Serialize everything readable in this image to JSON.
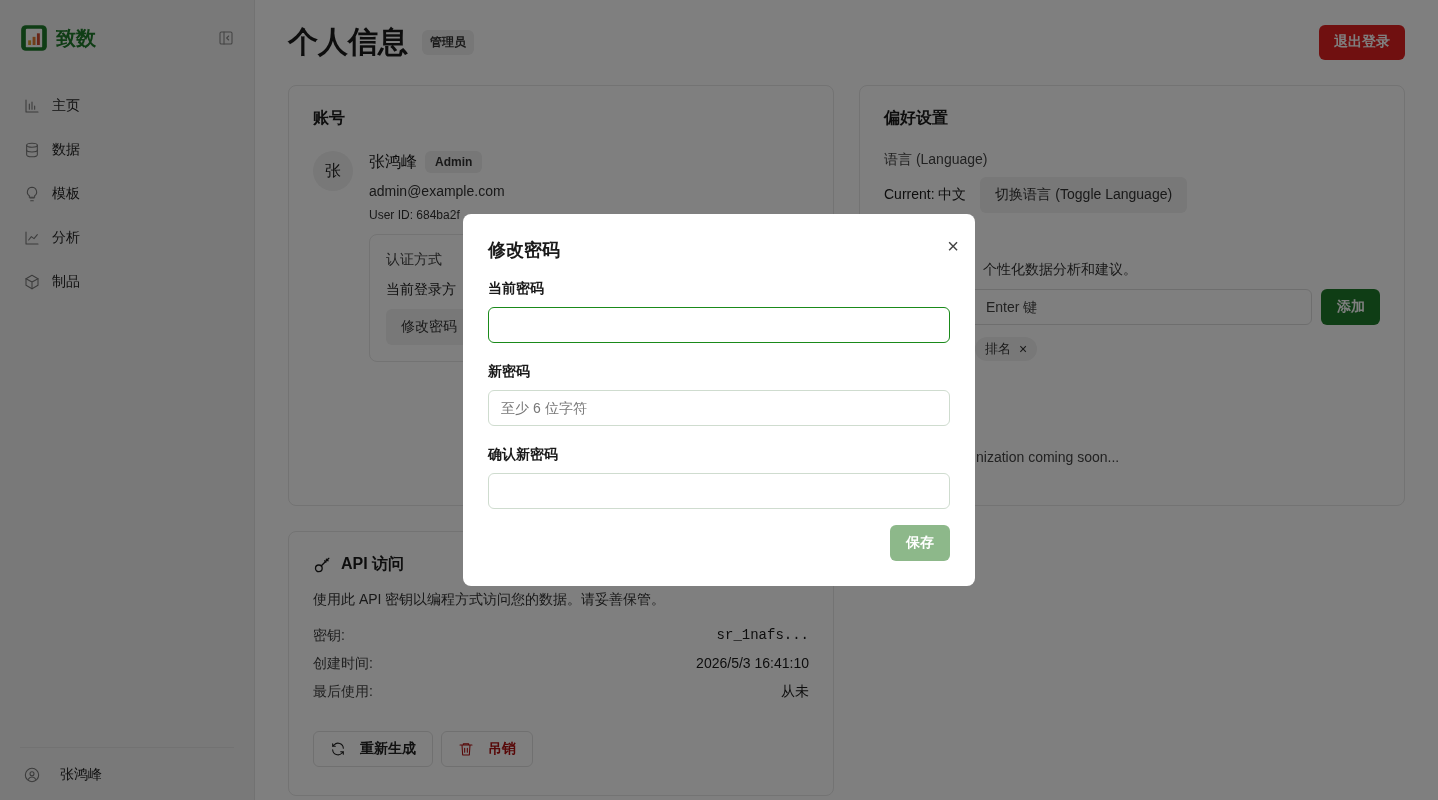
{
  "sidebar": {
    "brand": "致数",
    "nav": [
      {
        "label": "主页"
      },
      {
        "label": "数据"
      },
      {
        "label": "模板"
      },
      {
        "label": "分析"
      },
      {
        "label": "制品"
      }
    ],
    "user": "张鸿峰"
  },
  "header": {
    "title": "个人信息",
    "badge": "管理员",
    "logout": "退出登录"
  },
  "account_card": {
    "title": "账号",
    "avatar": "张",
    "name": "张鸿峰",
    "role": "Admin",
    "email": "admin@example.com",
    "user_id": "User ID: 684ba2f",
    "auth": {
      "label": "认证方式",
      "text": "当前登录方",
      "button": "修改密码"
    }
  },
  "preferences_card": {
    "title": "偏好设置",
    "language_label": "语言 (Language)",
    "current": "Current: 中文",
    "toggle_button": "切换语言 (Toggle Language)",
    "description": "个性化数据分析和建议。",
    "tag_input": {
      "placeholder": "Enter 键"
    },
    "add_button": "添加",
    "tags": [
      {
        "label": "排名",
        "remove": "×"
      }
    ],
    "note": "nization coming soon..."
  },
  "api_card": {
    "title": "API 访问",
    "description": "使用此 API 密钥以编程方式访问您的数据。请妥善保管。",
    "rows": [
      {
        "label": "密钥:",
        "value": "sr_1nafs...",
        "kind": "code"
      },
      {
        "label": "创建时间:",
        "value": "2026/5/3 16:41:10",
        "kind": "text"
      },
      {
        "label": "最后使用:",
        "value": "从未",
        "kind": "text"
      }
    ],
    "buttons": [
      {
        "label": "重新生成",
        "kind": "default"
      },
      {
        "label": "吊销",
        "kind": "danger"
      }
    ]
  },
  "dialog": {
    "title": "修改密码",
    "close": "×",
    "fields": [
      {
        "label": "当前密码",
        "focused": true
      },
      {
        "label": "新密码",
        "placeholder": "至少 6 位字符",
        "focused": false
      },
      {
        "label": "确认新密码",
        "focused": false
      }
    ],
    "save_button": {
      "label": "保存",
      "disabled": true
    }
  }
}
